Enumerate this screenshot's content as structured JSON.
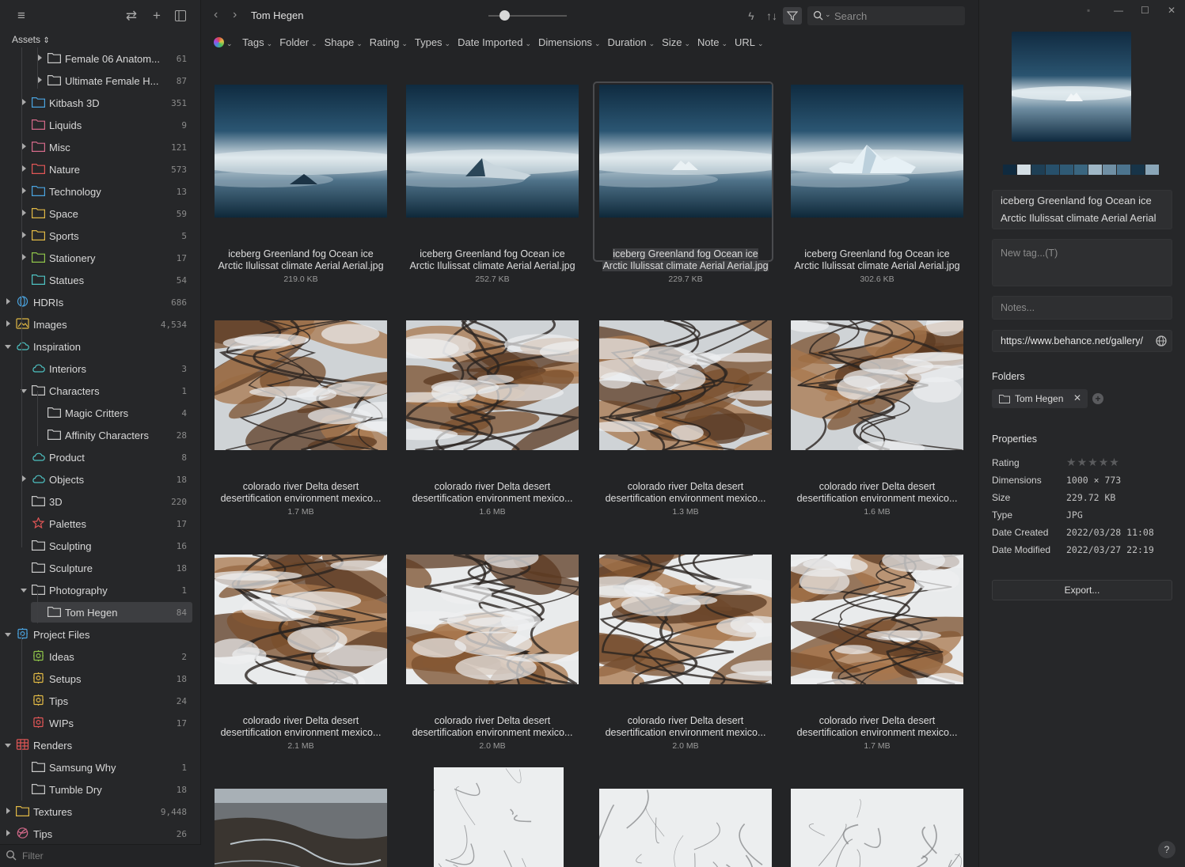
{
  "sidebar": {
    "assets_label": "Assets",
    "filter_placeholder": "Filter",
    "items": [
      {
        "label": "Female 06 Anatom...",
        "count": "61"
      },
      {
        "label": "Ultimate Female H...",
        "count": "87"
      },
      {
        "label": "Kitbash 3D",
        "count": "351"
      },
      {
        "label": "Liquids",
        "count": "9"
      },
      {
        "label": "Misc",
        "count": "121"
      },
      {
        "label": "Nature",
        "count": "573"
      },
      {
        "label": "Technology",
        "count": "13"
      },
      {
        "label": "Space",
        "count": "59"
      },
      {
        "label": "Sports",
        "count": "5"
      },
      {
        "label": "Stationery",
        "count": "17"
      },
      {
        "label": "Statues",
        "count": "54"
      },
      {
        "label": "HDRIs",
        "count": "686"
      },
      {
        "label": "Images",
        "count": "4,534"
      },
      {
        "label": "Inspiration",
        "count": ""
      },
      {
        "label": "Interiors",
        "count": "3"
      },
      {
        "label": "Characters",
        "count": "1"
      },
      {
        "label": "Magic Critters",
        "count": "4"
      },
      {
        "label": "Affinity Characters",
        "count": "28"
      },
      {
        "label": "Product",
        "count": "8"
      },
      {
        "label": "Objects",
        "count": "18"
      },
      {
        "label": "3D",
        "count": "220"
      },
      {
        "label": "Palettes",
        "count": "17"
      },
      {
        "label": "Sculpting",
        "count": "16"
      },
      {
        "label": "Sculpture",
        "count": "18"
      },
      {
        "label": "Photography",
        "count": "1"
      },
      {
        "label": "Tom Hegen",
        "count": "84"
      },
      {
        "label": "Project Files",
        "count": ""
      },
      {
        "label": "Ideas",
        "count": "2"
      },
      {
        "label": "Setups",
        "count": "18"
      },
      {
        "label": "Tips",
        "count": "24"
      },
      {
        "label": "WIPs",
        "count": "17"
      },
      {
        "label": "Renders",
        "count": ""
      },
      {
        "label": "Samsung Why",
        "count": "1"
      },
      {
        "label": "Tumble Dry",
        "count": "18"
      },
      {
        "label": "Textures",
        "count": "9,448"
      },
      {
        "label": "Tips",
        "count": "26"
      }
    ]
  },
  "toolbar": {
    "title": "Tom Hegen",
    "search_placeholder": "Search"
  },
  "filters": [
    "Tags",
    "Folder",
    "Shape",
    "Rating",
    "Types",
    "Date Imported",
    "Dimensions",
    "Duration",
    "Size",
    "Note",
    "URL"
  ],
  "grid": {
    "items": [
      {
        "name1": "iceberg Greenland fog Ocean ice",
        "name2": "Arctic Ilulissat climate Aerial Aerial.jpg",
        "size": "219.0 KB"
      },
      {
        "name1": "iceberg Greenland fog Ocean ice",
        "name2": "Arctic Ilulissat climate Aerial Aerial.jpg",
        "size": "252.7 KB"
      },
      {
        "name1": "iceberg Greenland fog Ocean ice",
        "name2": "Arctic Ilulissat climate Aerial Aerial.jpg",
        "size": "229.7 KB"
      },
      {
        "name1": "iceberg Greenland fog Ocean ice",
        "name2": "Arctic Ilulissat climate Aerial Aerial.jpg",
        "size": "302.6 KB"
      },
      {
        "name1": "colorado river Delta desert",
        "name2": "desertification environment mexico...",
        "size": "1.7 MB"
      },
      {
        "name1": "colorado river Delta desert",
        "name2": "desertification environment mexico...",
        "size": "1.6 MB"
      },
      {
        "name1": "colorado river Delta desert",
        "name2": "desertification environment mexico...",
        "size": "1.3 MB"
      },
      {
        "name1": "colorado river Delta desert",
        "name2": "desertification environment mexico...",
        "size": "1.6 MB"
      },
      {
        "name1": "colorado river Delta desert",
        "name2": "desertification environment mexico...",
        "size": "2.1 MB"
      },
      {
        "name1": "colorado river Delta desert",
        "name2": "desertification environment mexico...",
        "size": "2.0 MB"
      },
      {
        "name1": "colorado river Delta desert",
        "name2": "desertification environment mexico...",
        "size": "2.0 MB"
      },
      {
        "name1": "colorado river Delta desert",
        "name2": "desertification environment mexico...",
        "size": "1.7 MB"
      }
    ]
  },
  "inspector": {
    "name_line1": "iceberg Greenland fog Ocean ice",
    "name_line2": "Arctic Ilulissat climate Aerial Aerial",
    "tag_placeholder": "New tag...(T)",
    "notes_placeholder": "Notes...",
    "url": "https://www.behance.net/gallery/",
    "folders_heading": "Folders",
    "folder_chip": "Tom Hegen",
    "properties_heading": "Properties",
    "properties": [
      {
        "key": "Rating",
        "value": ""
      },
      {
        "key": "Dimensions",
        "value": "1000 × 773"
      },
      {
        "key": "Size",
        "value": "229.72 KB"
      },
      {
        "key": "Type",
        "value": "JPG"
      },
      {
        "key": "Date Created",
        "value": "2022/03/28 11:08"
      },
      {
        "key": "Date Modified",
        "value": "2022/03/27 22:19"
      }
    ],
    "rating_stars": 0,
    "export_label": "Export...",
    "help_label": "?",
    "palette": [
      "#0f2a3f",
      "#d3dee4",
      "#1e3f55",
      "#27506b",
      "#2f5a75",
      "#3a6680",
      "#9fb7c6",
      "#6f8fa4",
      "#4c748e",
      "#173448",
      "#8aa6b8"
    ]
  }
}
